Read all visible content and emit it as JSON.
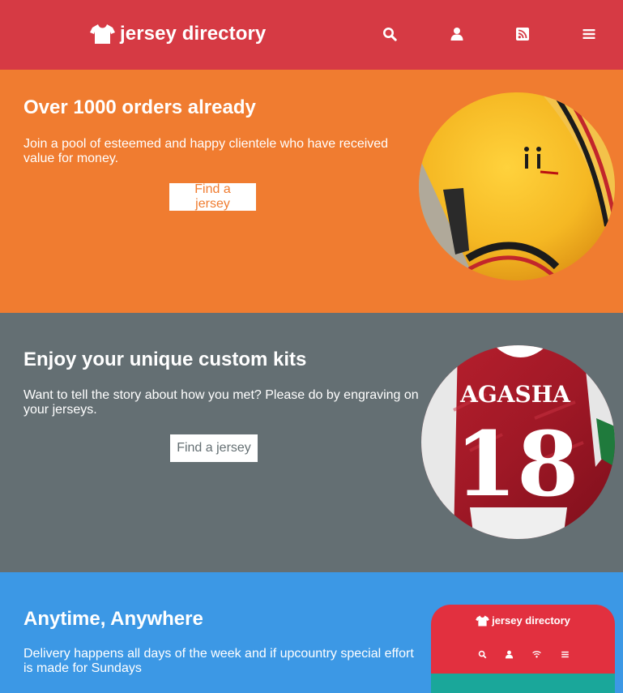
{
  "header": {
    "brand_name": "jersey directory",
    "brand_icon": "tshirt-icon",
    "nav_icons": [
      "search-icon",
      "user-icon",
      "rss-icon",
      "hamburger-menu-icon"
    ],
    "background_color": "#d63a44"
  },
  "sections": [
    {
      "title": "Over 1000 orders already",
      "text": "Join a pool of esteemed and happy clientele who have received value for money.",
      "button_label": "Find a jersey",
      "background_color": "#f07c30",
      "button_text_color": "#f07c30",
      "image": "yellow-jersey-sleeve-photo"
    },
    {
      "title": "Enjoy your unique custom kits",
      "text": "Want to tell the story about how you met? Please do by engraving on your jerseys.",
      "button_label": "Find a jersey",
      "background_color": "#646f73",
      "button_text_color": "#646f73",
      "image": "red-jersey-back-photo",
      "jersey_name": "AGASHA",
      "jersey_number": "18"
    },
    {
      "title": "Anytime, Anywhere",
      "text": "Delivery happens all days of the week and if upcountry special effort is made for Sundays",
      "background_color": "#3c98e5",
      "phone_preview": {
        "brand_name": "jersey directory",
        "icons": [
          "search-icon",
          "user-icon",
          "wifi-icon",
          "hamburger-menu-icon"
        ]
      }
    }
  ]
}
